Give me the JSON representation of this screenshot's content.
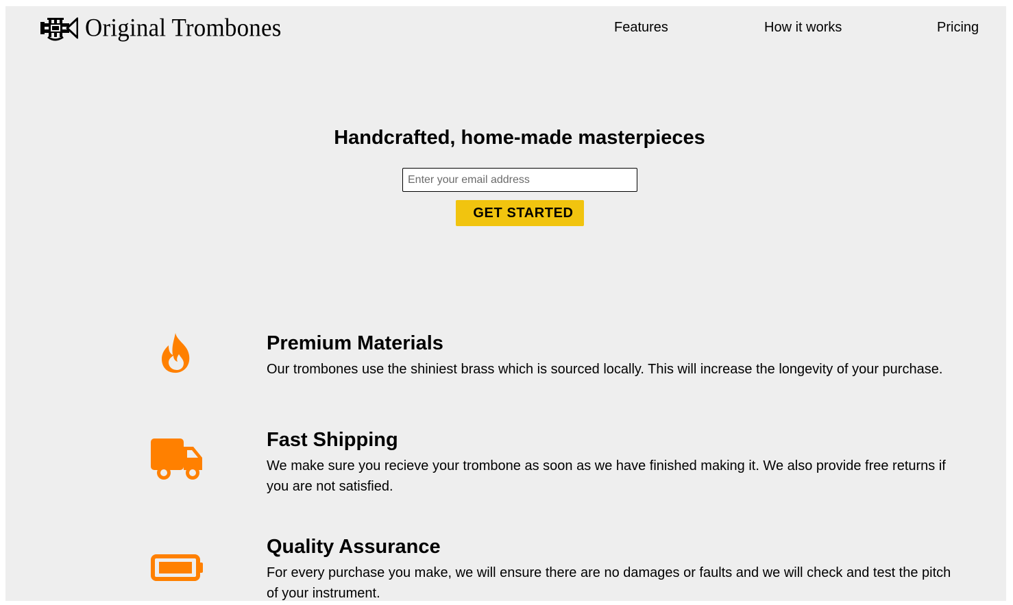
{
  "brand": {
    "name": "Original Trombones",
    "logo_icon": "trombone-icon"
  },
  "nav": {
    "items": [
      {
        "label": "Features"
      },
      {
        "label": "How it works"
      },
      {
        "label": "Pricing"
      }
    ]
  },
  "hero": {
    "title": "Handcrafted, home-made masterpieces",
    "email_placeholder": "Enter your email address",
    "email_value": "",
    "cta_label": "GET STARTED",
    "cta_color": "#f1c40f"
  },
  "features": {
    "accent_color": "#ff8000",
    "items": [
      {
        "icon": "fire-icon",
        "title": "Premium Materials",
        "description": "Our trombones use the shiniest brass which is sourced locally. This will increase the longevity of your purchase."
      },
      {
        "icon": "truck-icon",
        "title": "Fast Shipping",
        "description": "We make sure you recieve your trombone as soon as we have finished making it. We also provide free returns if you are not satisfied."
      },
      {
        "icon": "battery-icon",
        "title": "Quality Assurance",
        "description": "For every purchase you make, we will ensure there are no damages or faults and we will check and test the pitch of your instrument."
      }
    ]
  }
}
